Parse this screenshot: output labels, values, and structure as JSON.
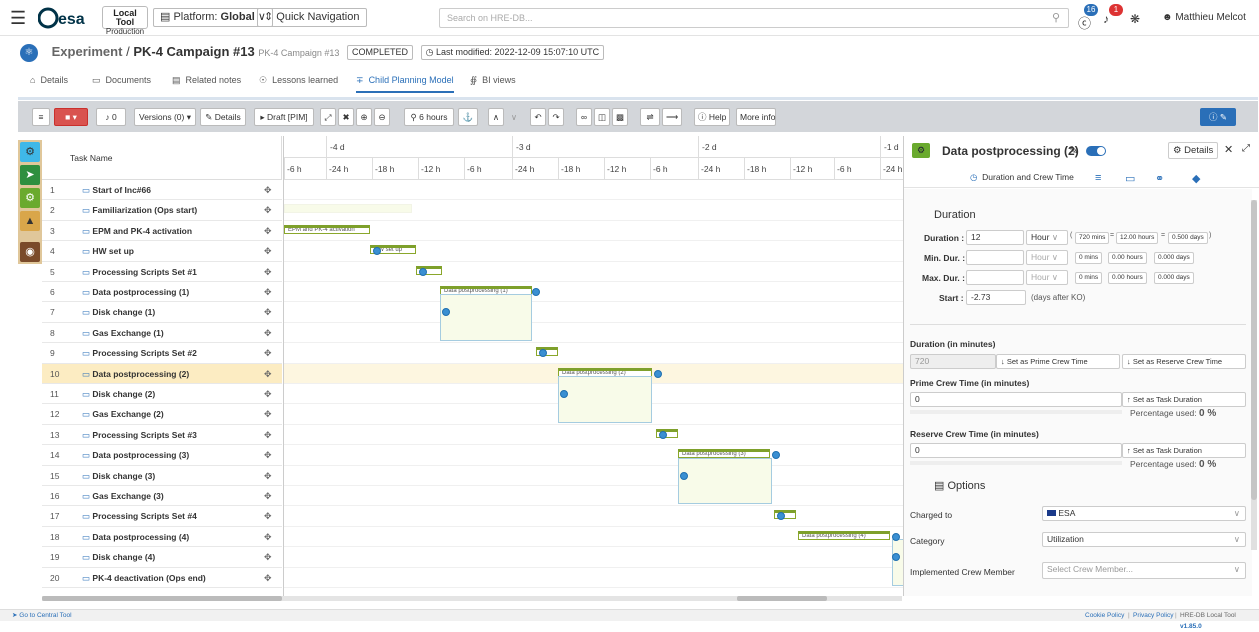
{
  "topbar": {
    "local_tool": "Local Tool",
    "production": "Production",
    "platform_label": "Platform:",
    "platform_value": "Global",
    "quick_nav": "Quick Navigation",
    "search_placeholder": "Search on HRE-DB...",
    "notif_count_1": "16",
    "notif_count_2": "1",
    "user": "Matthieu Melcot"
  },
  "breadcrumb": {
    "experiment": "Experiment",
    "separator": "/",
    "campaign": "PK-4 Campaign #13",
    "subtitle": "PK-4 Campaign #13",
    "status": "COMPLETED",
    "modified": "Last modified: 2022-12-09 15:07:10 UTC"
  },
  "tabs": [
    "Details",
    "Documents",
    "Related notes",
    "Lessons learned",
    "Child Planning Model",
    "BI views"
  ],
  "toolbar": {
    "notif": "0",
    "versions": "Versions (0)",
    "details": "Details",
    "draft": "Draft [PIM]",
    "hours": "6 hours",
    "help": "Help",
    "more_info": "More info"
  },
  "grid": {
    "header": "Task Name",
    "rows": [
      {
        "num": "1",
        "name": "Start of Inc#66"
      },
      {
        "num": "2",
        "name": "Familiarization (Ops start)"
      },
      {
        "num": "3",
        "name": "EPM and PK-4 activation"
      },
      {
        "num": "4",
        "name": "HW set up"
      },
      {
        "num": "5",
        "name": "Processing Scripts Set #1"
      },
      {
        "num": "6",
        "name": "Data postprocessing (1)"
      },
      {
        "num": "7",
        "name": "Disk change (1)"
      },
      {
        "num": "8",
        "name": "Gas Exchange (1)"
      },
      {
        "num": "9",
        "name": "Processing Scripts Set #2"
      },
      {
        "num": "10",
        "name": "Data postprocessing (2)"
      },
      {
        "num": "11",
        "name": "Disk change (2)"
      },
      {
        "num": "12",
        "name": "Gas Exchange (2)"
      },
      {
        "num": "13",
        "name": "Processing Scripts Set #3"
      },
      {
        "num": "14",
        "name": "Data postprocessing (3)"
      },
      {
        "num": "15",
        "name": "Disk change (3)"
      },
      {
        "num": "16",
        "name": "Gas Exchange (3)"
      },
      {
        "num": "17",
        "name": "Processing Scripts Set #4"
      },
      {
        "num": "18",
        "name": "Data postprocessing (4)"
      },
      {
        "num": "19",
        "name": "Disk change (4)"
      },
      {
        "num": "20",
        "name": "PK-4 deactivation (Ops end)"
      }
    ]
  },
  "gantt": {
    "days": [
      "-4 d",
      "-3 d",
      "-2 d",
      "-1 d"
    ],
    "hours": [
      "-6 h",
      "-24 h",
      "-18 h",
      "-12 h",
      "-6 h",
      "-24 h",
      "-18 h",
      "-12 h",
      "-6 h",
      "-24 h",
      "-18 h",
      "-12 h",
      "-6 h",
      "-24 h"
    ],
    "bar_labels": {
      "epm": "EPM and PK-4 activation",
      "hw": "HW set up",
      "dp1": "Data postprocessing (1)",
      "dp2": "Data postprocessing (2)",
      "dp3": "Data postprocessing (3)",
      "dp4": "Data postprocessing (4)"
    }
  },
  "panel": {
    "title": "Data postprocessing (2)",
    "details_btn": "Details",
    "subtab": "Duration and Crew Time",
    "duration_section": "Duration",
    "duration_label": "Duration :",
    "duration_value": "12",
    "duration_unit": "Hour",
    "dur_mins": "720 mins",
    "dur_hours": "12.00 hours",
    "dur_days": "0.500 days",
    "min_label": "Min. Dur. :",
    "max_label": "Max. Dur. :",
    "unit_grey": "Hour",
    "zero_mins": "0 mins",
    "zero_hours": "0.00 hours",
    "zero_days": "0.000 days",
    "start_label": "Start :",
    "start_value": "-2.73",
    "start_hint": "(days after KO)",
    "dim_label": "Duration (in minutes)",
    "dim_value": "720",
    "set_prime": "Set as Prime Crew Time",
    "set_reserve": "Set as Reserve Crew Time",
    "prime_label": "Prime Crew Time (in minutes)",
    "prime_value": "0",
    "set_task": "Set as Task Duration",
    "pct_used": "Percentage used:",
    "pct_value": "0 %",
    "reserve_label": "Reserve Crew Time (in minutes)",
    "reserve_value": "0",
    "options_section": "Options",
    "charged_label": "Charged to",
    "charged_value": "ESA",
    "category_label": "Category",
    "category_value": "Utilization",
    "crew_label": "Implemented Crew Member",
    "crew_placeholder": "Select Crew Member..."
  },
  "footer": {
    "go_central": "Go to Central Tool",
    "cookie": "Cookie Policy",
    "privacy": "Privacy Policy",
    "version_text": "HRE-DB Local Tool",
    "version": "v1.85.0"
  },
  "colors": {
    "accent": "#2a6fb8",
    "bar_green": "#7ea02b",
    "selected_row": "#fcecc2",
    "toggle": "#2a6fb8"
  }
}
